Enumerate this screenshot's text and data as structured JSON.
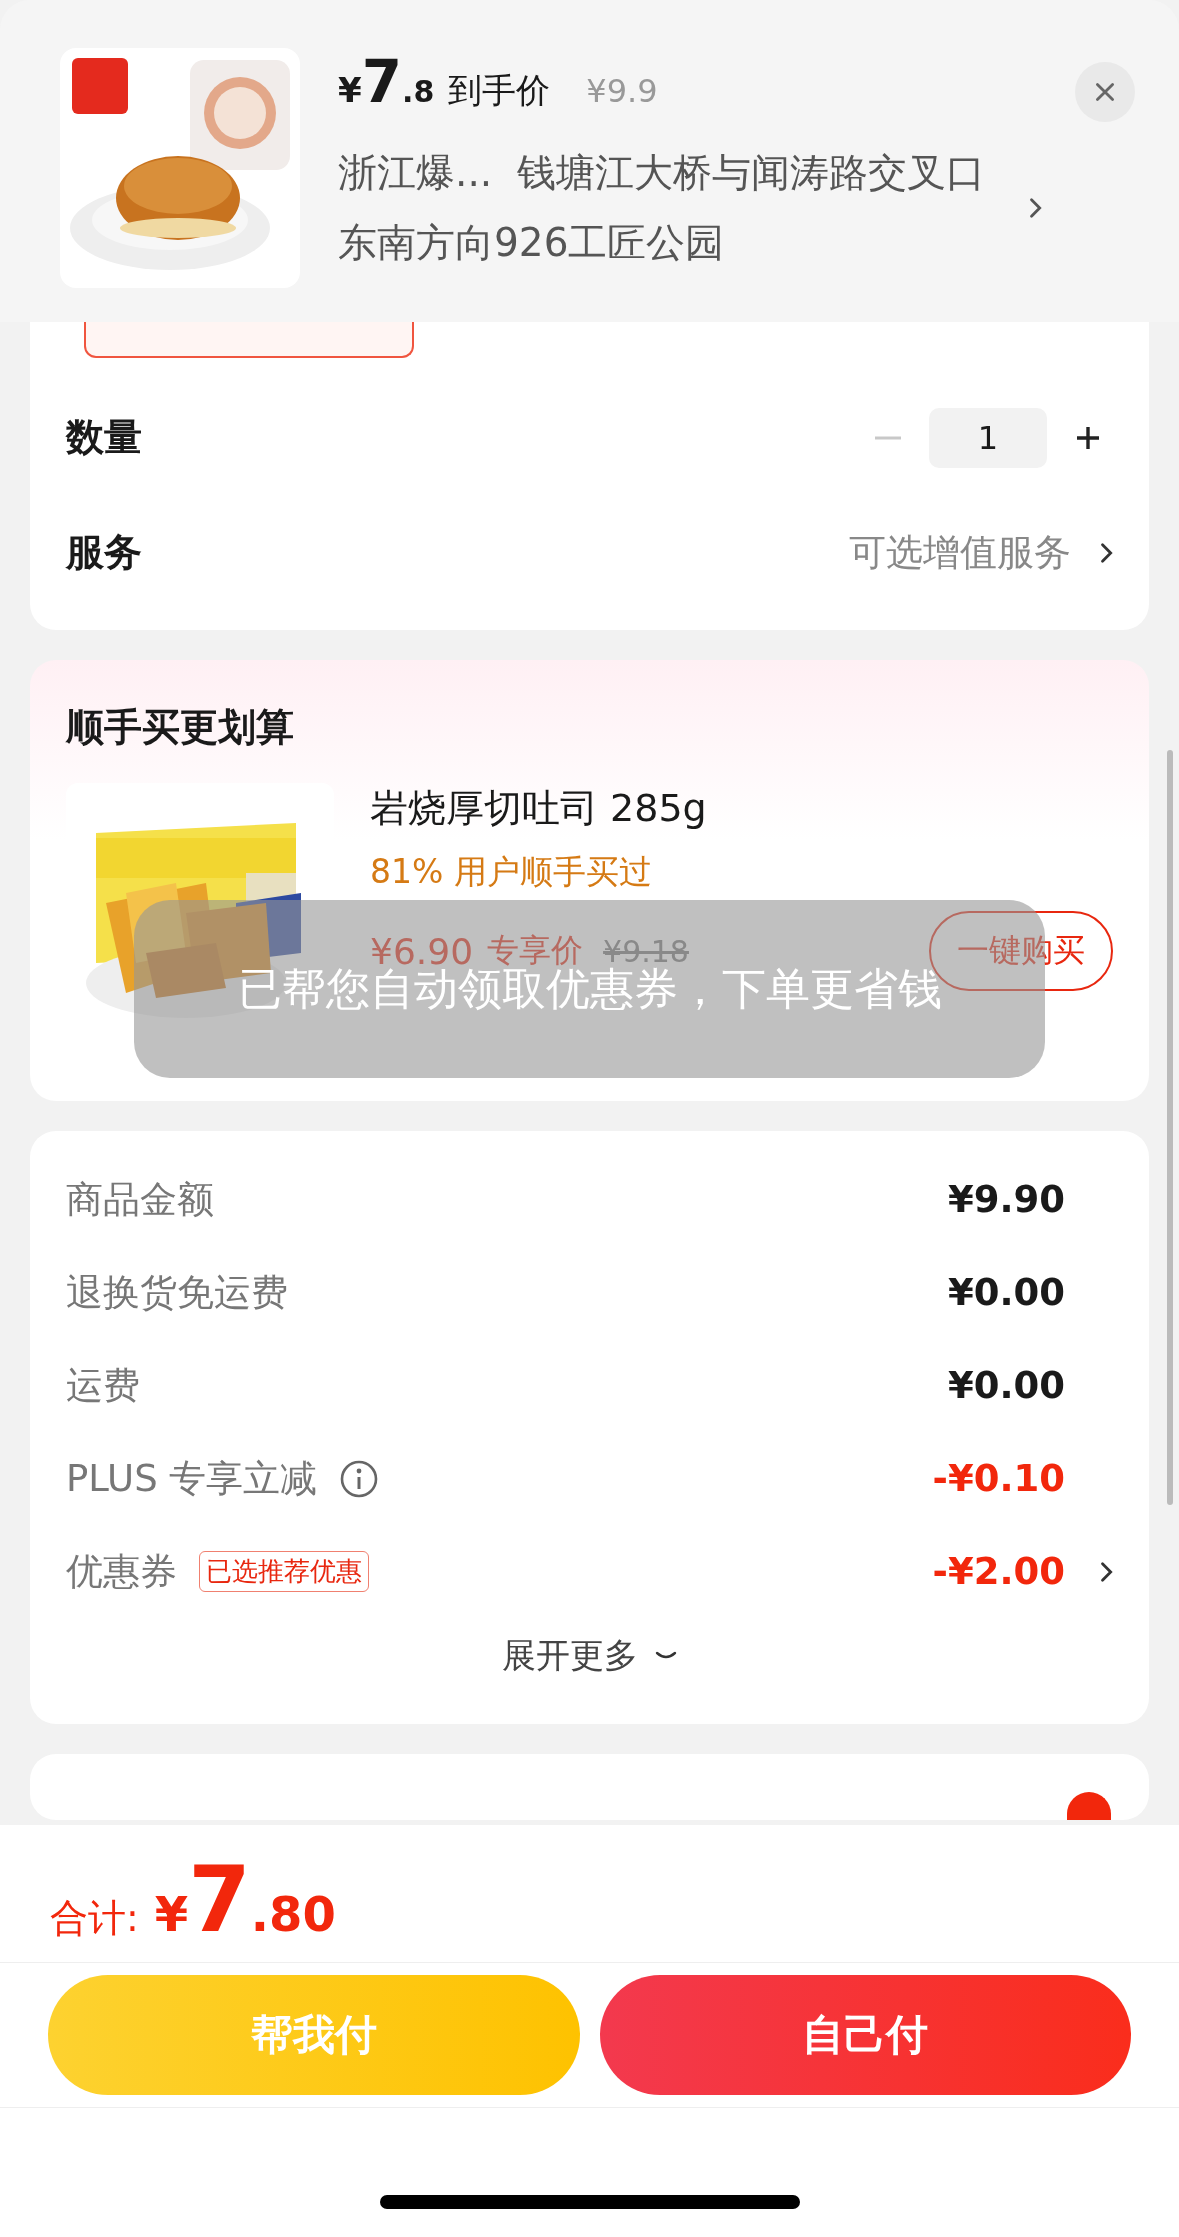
{
  "header": {
    "price_currency": "¥",
    "price_integer": "7",
    "price_decimal": ".8",
    "price_label": "到手价",
    "original_price": "¥9.9",
    "address": "浙江爆...  钱塘江大桥与闻涛路交叉口东南方向926工匠公园"
  },
  "quantity": {
    "label": "数量",
    "value": "1",
    "minus_disabled": true
  },
  "service": {
    "label": "服务",
    "value": "可选增值服务"
  },
  "addon": {
    "title": "顺手买更划算",
    "products": [
      {
        "name": "岩烧厚切吐司 285g",
        "social_proof": "81% 用户顺手买过",
        "price": "¥6.90",
        "price_label": "专享价",
        "original_price": "¥9.18",
        "button": "一键购买"
      }
    ]
  },
  "toast": {
    "text": "已帮您自动领取优惠券，下单更省钱"
  },
  "summary": {
    "rows": [
      {
        "kind": "plain",
        "label": "商品金额",
        "value": "¥9.90",
        "discount": false
      },
      {
        "kind": "plain",
        "label": "退换货免运费",
        "value": "¥0.00",
        "discount": false
      },
      {
        "kind": "plain",
        "label": "运费",
        "value": "¥0.00",
        "discount": false
      },
      {
        "kind": "info",
        "label": "PLUS 专享立减",
        "value": "-¥0.10",
        "discount": true
      },
      {
        "kind": "link",
        "label": "优惠券",
        "tag": "已选推荐优惠",
        "value": "-¥2.00",
        "discount": true
      }
    ],
    "expand": "展开更多"
  },
  "payment": {
    "selected": true
  },
  "total": {
    "label": "合计:",
    "currency": "¥",
    "integer": "7",
    "decimal": ".80"
  },
  "buttons": [
    {
      "label": "帮我付",
      "kind": "secondary"
    },
    {
      "label": "自己付",
      "kind": "primary"
    }
  ]
}
